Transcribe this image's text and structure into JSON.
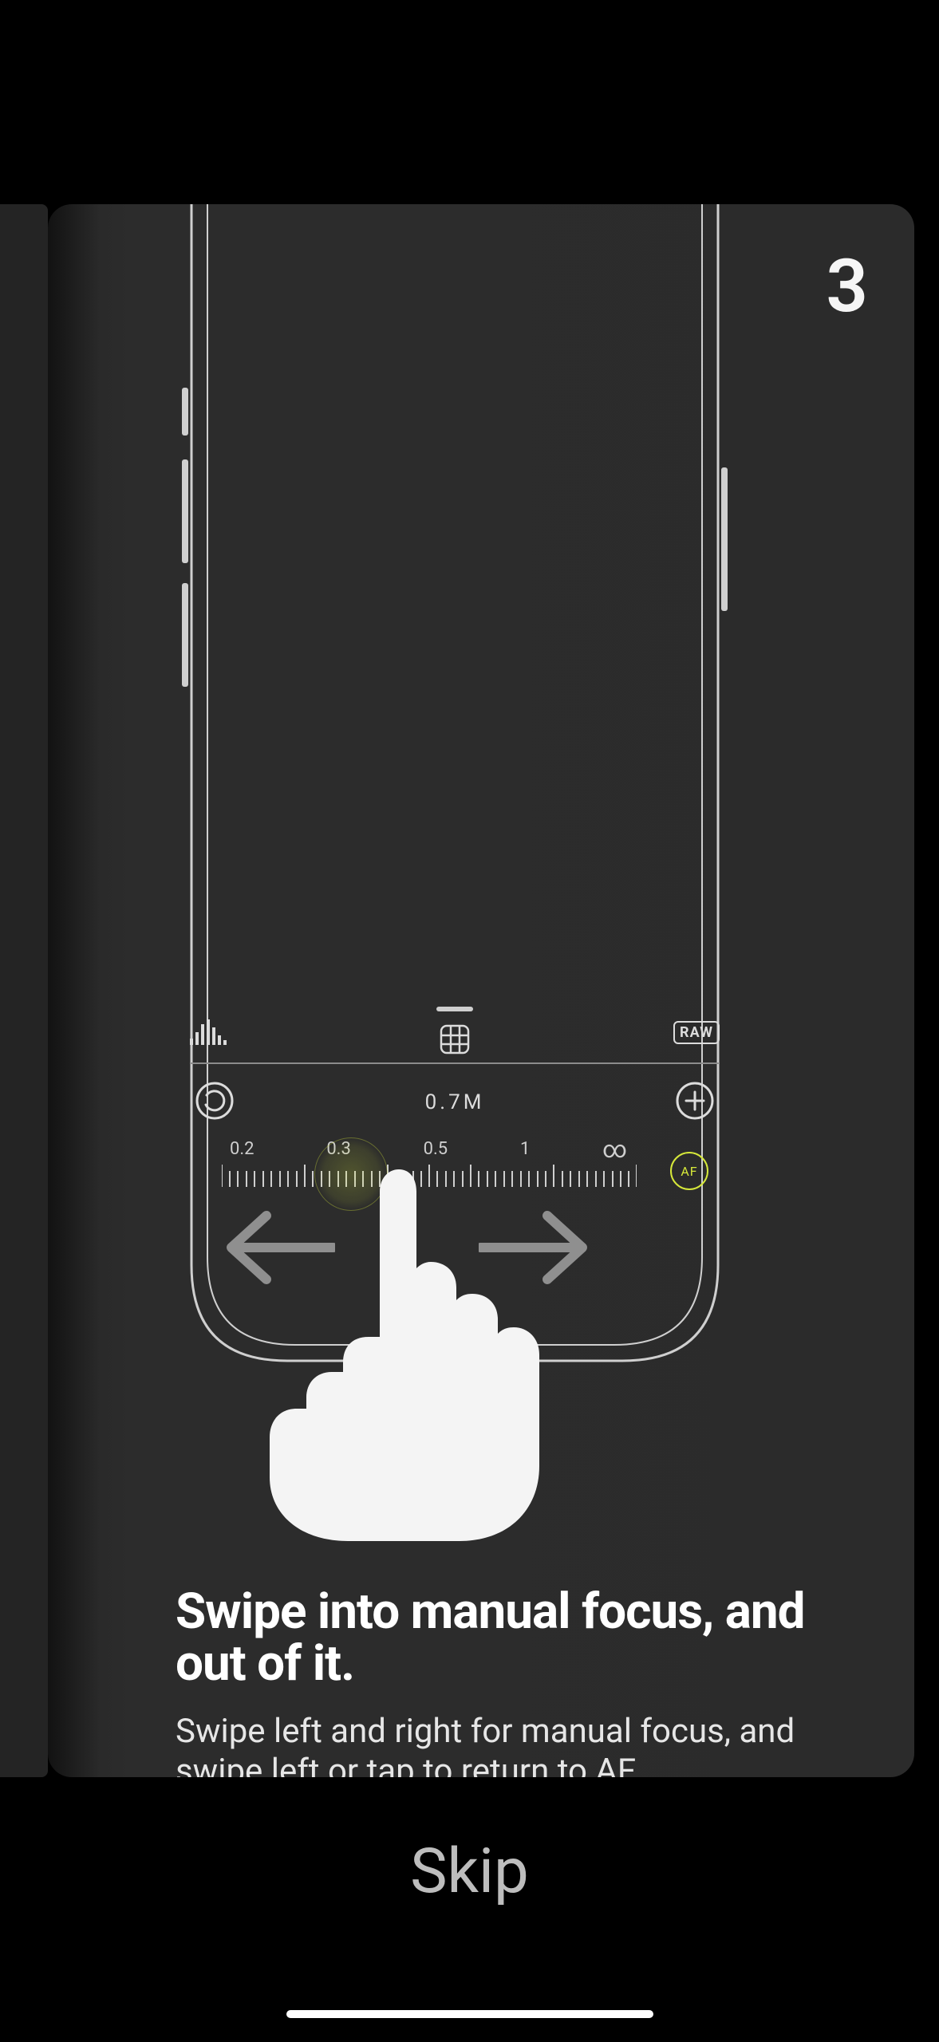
{
  "step_number": "3",
  "headline": "Swipe into manual focus, and out of it.",
  "body": "Swipe left and right for manual focus, and swipe left or tap to return to AF.",
  "skip_label": "Skip",
  "illustration": {
    "raw_badge": "RAW",
    "focus_value": "0.7M",
    "af_label": "AF",
    "ruler_labels": [
      "0.2",
      "0.3",
      "0.5",
      "1",
      "∞"
    ],
    "icons": {
      "histogram": "histogram-icon",
      "grid": "grid-icon",
      "refresh": "capture-reset-icon",
      "plus": "plus-icon"
    }
  },
  "colors": {
    "accent_yellow": "#d6e83a",
    "card_bg": "#2b2b2b"
  }
}
